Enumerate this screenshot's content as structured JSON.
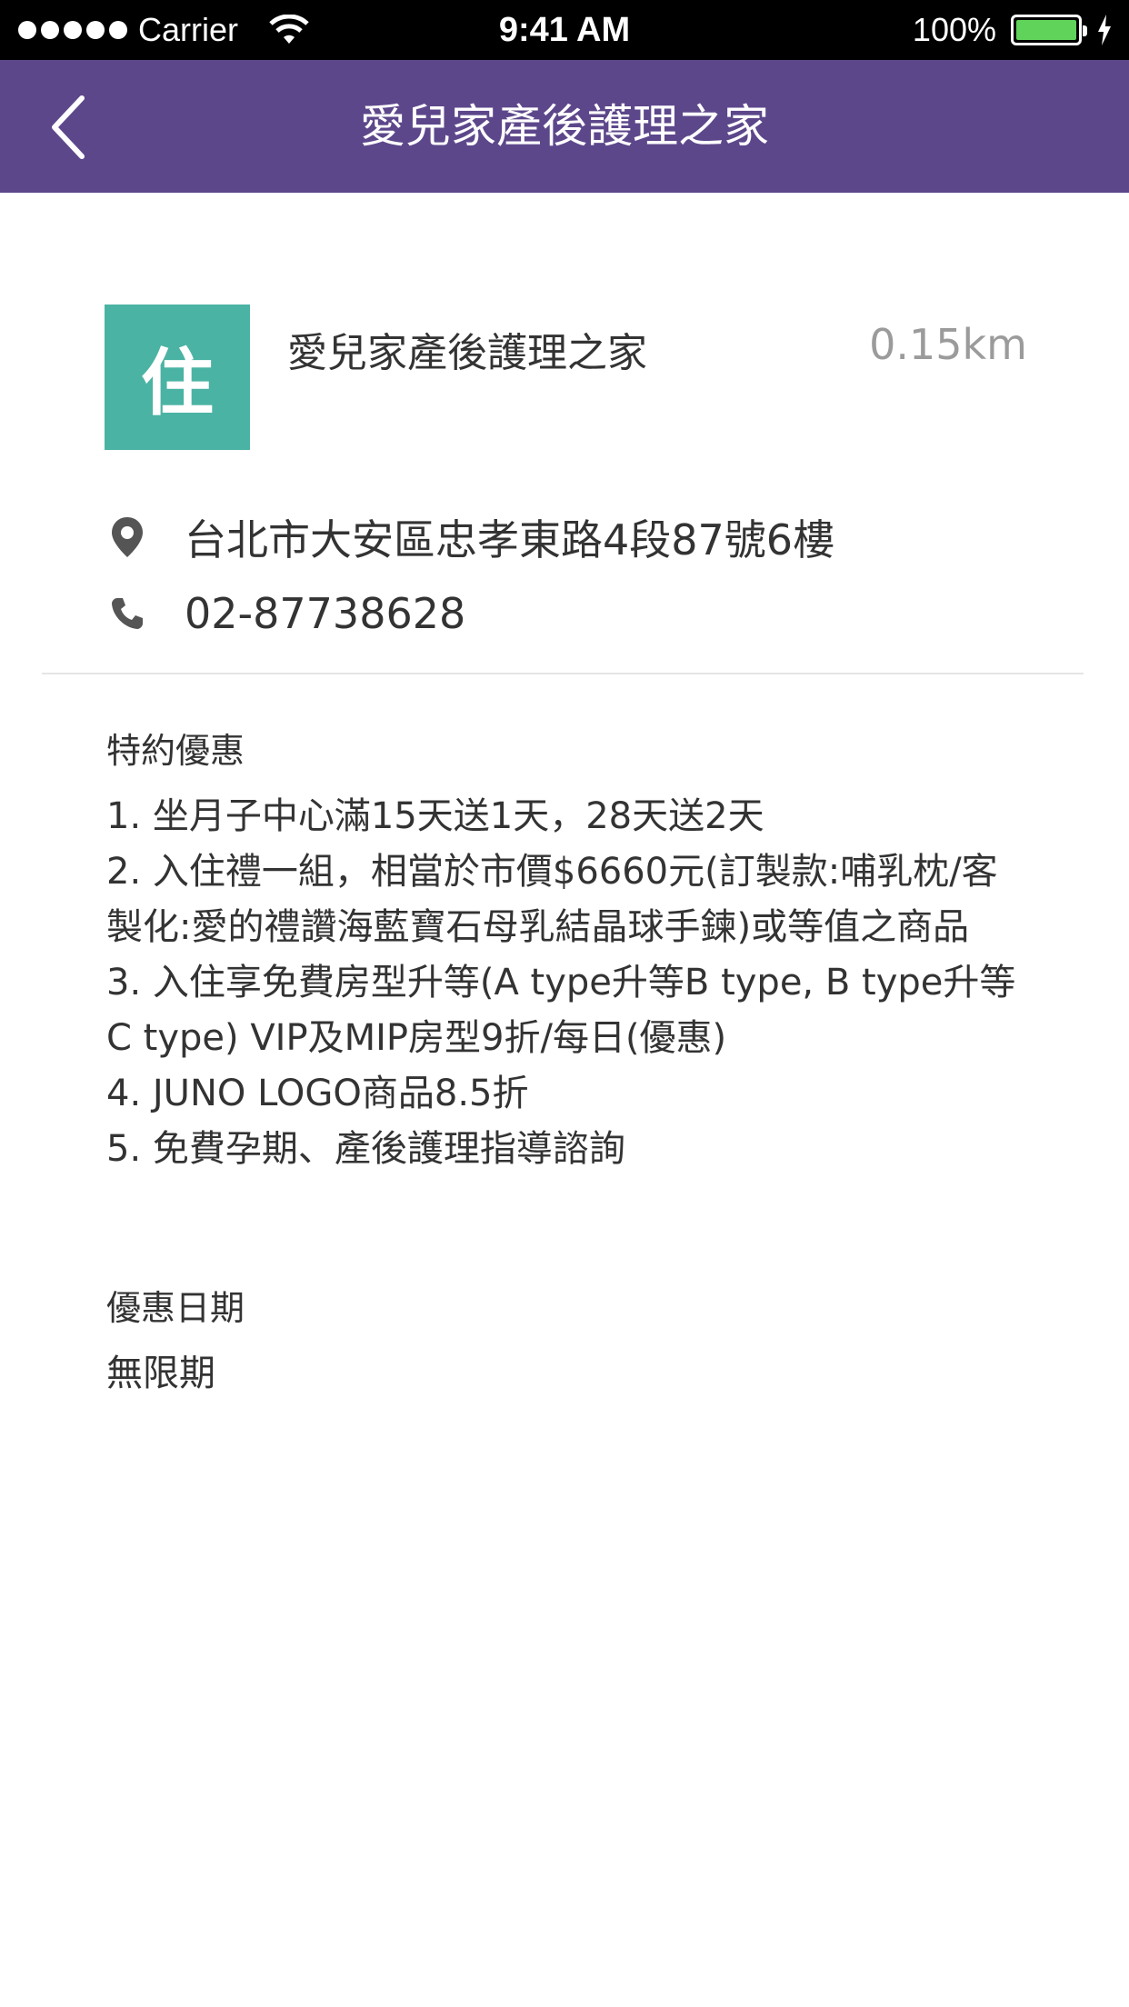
{
  "status_bar": {
    "carrier": "Carrier",
    "time": "9:41 AM",
    "battery": "100%"
  },
  "nav": {
    "title": "愛兒家產後護理之家",
    "back_icon": "chevron-left-icon"
  },
  "store": {
    "badge": "住",
    "badge_color": "#4bb3a4",
    "name": "愛兒家產後護理之家",
    "distance": "0.15km",
    "address": "台北市大安區忠孝東路4段87號6樓",
    "phone": "02-87738628"
  },
  "offer": {
    "title": "特約優惠",
    "items": [
      "1. 坐月子中心滿15天送1天，28天送2天",
      "2. 入住禮一組，相當於市價$6660元(訂製款:哺乳枕/客製化:愛的禮讚海藍寶石母乳結晶球手鍊)或等值之商品",
      "3. 入住享免費房型升等(A type升等B type, B type升等C type) VIP及MIP房型9折/每日(優惠)",
      "4. JUNO LOGO商品8.5折",
      "5. 免費孕期、產後護理指導諮詢"
    ]
  },
  "date": {
    "title": "優惠日期",
    "value": "無限期"
  },
  "colors": {
    "nav_bg": "#5d478b",
    "distance": "#9b9b9b"
  }
}
